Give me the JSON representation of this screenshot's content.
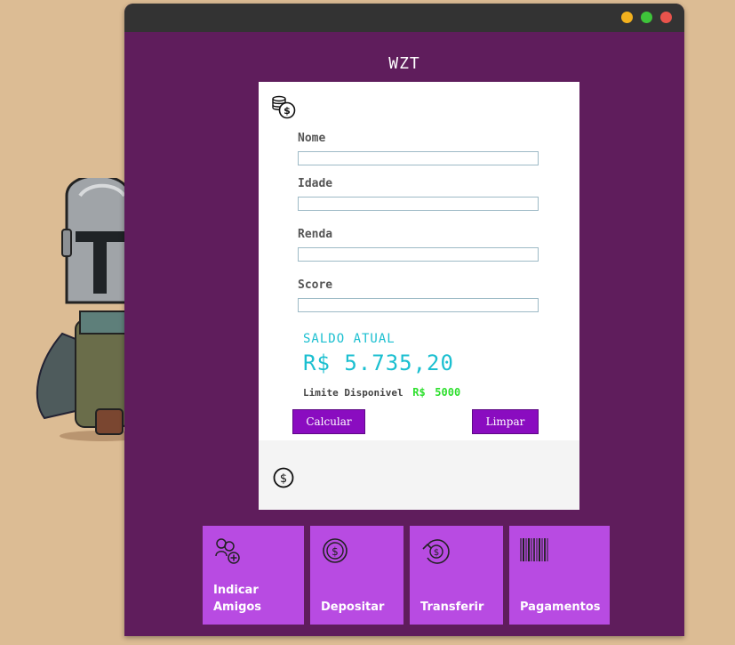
{
  "window": {
    "brand": "WZT",
    "controls": [
      "minimize",
      "maximize",
      "close"
    ]
  },
  "form": {
    "fields": [
      {
        "label": "Nome",
        "value": ""
      },
      {
        "label": "Idade",
        "value": ""
      },
      {
        "label": "Renda",
        "value": ""
      },
      {
        "label": "Score",
        "value": ""
      }
    ],
    "saldo_label": "SALDO ATUAL",
    "saldo_value": "R$ 5.735,20",
    "limite_label": "Limite Disponivel",
    "limite_currency": "R$",
    "limite_value": "5000",
    "calcular_label": "Calcular",
    "limpar_label": "Limpar"
  },
  "tiles": [
    {
      "label": "Indicar Amigos",
      "icon": "add-friends-icon"
    },
    {
      "label": "Depositar",
      "icon": "deposit-coin-icon"
    },
    {
      "label": "Transferir",
      "icon": "transfer-coin-icon"
    },
    {
      "label": "Pagamentos",
      "icon": "barcode-icon"
    }
  ],
  "colors": {
    "background": "#dcbc94",
    "window": "#5f1d5c",
    "titlebar": "#333333",
    "accent": "#8a0cc0",
    "tile": "#b84be2",
    "saldo": "#1bbfd0",
    "limit_value": "#2ddf2d"
  }
}
